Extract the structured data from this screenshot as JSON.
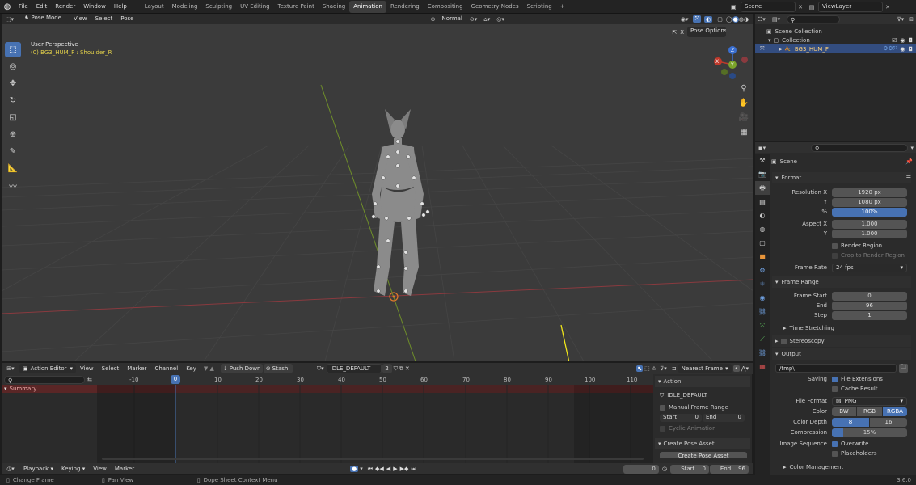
{
  "menubar": {
    "menus": [
      "File",
      "Edit",
      "Render",
      "Window",
      "Help"
    ],
    "workspaces": [
      "Layout",
      "Modeling",
      "Sculpting",
      "UV Editing",
      "Texture Paint",
      "Shading",
      "Animation",
      "Rendering",
      "Compositing",
      "Geometry Nodes",
      "Scripting"
    ],
    "active_workspace": "Animation",
    "add_tab": "+",
    "scene": "Scene",
    "view_layer": "ViewLayer"
  },
  "viewport": {
    "mode": "Pose Mode",
    "menus": [
      "View",
      "Select",
      "Pose"
    ],
    "orientation": "Normal",
    "pose_options": "Pose Options",
    "view_name": "User Perspective",
    "object_info": "(0) BG3_HUM_F : Shoulder_R",
    "gizmo": {
      "x": "X",
      "y": "Y",
      "z": "Z"
    }
  },
  "outliner": {
    "scene_collection": "Scene Collection",
    "collection": "Collection",
    "object": "BG3_HUM_F"
  },
  "properties": {
    "title": "Scene",
    "format": {
      "header": "Format",
      "resolution_x_label": "Resolution X",
      "resolution_x": "1920 px",
      "y_label": "Y",
      "resolution_y": "1080 px",
      "percent_label": "%",
      "percent": "100%",
      "aspect_x_label": "Aspect X",
      "aspect_x": "1.000",
      "aspect_y_label": "Y",
      "aspect_y": "1.000",
      "render_region": "Render Region",
      "crop": "Crop to Render Region",
      "frame_rate_label": "Frame Rate",
      "frame_rate": "24 fps"
    },
    "frame_range": {
      "header": "Frame Range",
      "start_label": "Frame Start",
      "start": "0",
      "end_label": "End",
      "end": "96",
      "step_label": "Step",
      "step": "1"
    },
    "time_stretching": "Time Stretching",
    "stereoscopy": "Stereoscopy",
    "output": {
      "header": "Output",
      "path": "/tmp\\",
      "saving_label": "Saving",
      "file_extensions": "File Extensions",
      "cache_result": "Cache Result",
      "file_format_label": "File Format",
      "file_format": "PNG",
      "color_label": "Color",
      "color_options": [
        "BW",
        "RGB",
        "RGBA"
      ],
      "color_active": "RGBA",
      "color_depth_label": "Color Depth",
      "color_depth_options": [
        "8",
        "16"
      ],
      "compression_label": "Compression",
      "compression": "15%",
      "compression_fraction": 0.15,
      "image_sequence_label": "Image Sequence",
      "overwrite": "Overwrite",
      "placeholders": "Placeholders"
    },
    "color_management": "Color Management"
  },
  "action_editor": {
    "editor": "Action Editor",
    "menus": [
      "View",
      "Select",
      "Marker",
      "Channel",
      "Key"
    ],
    "push_down": "Push Down",
    "stash": "Stash",
    "action_name": "IDLE_DEFAULT",
    "users": "2",
    "snapping": "Nearest Frame",
    "summary": "Summary",
    "current_frame": "0",
    "ticks": [
      "-10",
      "0",
      "10",
      "20",
      "30",
      "40",
      "50",
      "60",
      "70",
      "80",
      "90",
      "100",
      "110"
    ],
    "sidebar": {
      "action_header": "Action",
      "action_name": "IDLE_DEFAULT",
      "manual_frame_range": "Manual Frame Range",
      "start_label": "Start",
      "start": "0",
      "end_label": "End",
      "end": "0",
      "cyclic": "Cyclic Animation",
      "create_pose_header": "Create Pose Asset",
      "create_pose_button": "Create Pose Asset"
    }
  },
  "timeline": {
    "menus": [
      "Playback",
      "Keying",
      "View",
      "Marker"
    ],
    "current_frame": "0",
    "start_label": "Start",
    "start": "0",
    "end_label": "End",
    "end": "96"
  },
  "statusbar": {
    "left": "Change Frame",
    "middle": "Pan View",
    "right": "Dope Sheet Context Menu",
    "version": "3.6.0"
  },
  "colors": {
    "accent": "#4772b3",
    "annotation": "#f0e61a",
    "x_axis": "#c0392b",
    "y_axis": "#7ba42a",
    "z_axis": "#3a6fd1"
  }
}
